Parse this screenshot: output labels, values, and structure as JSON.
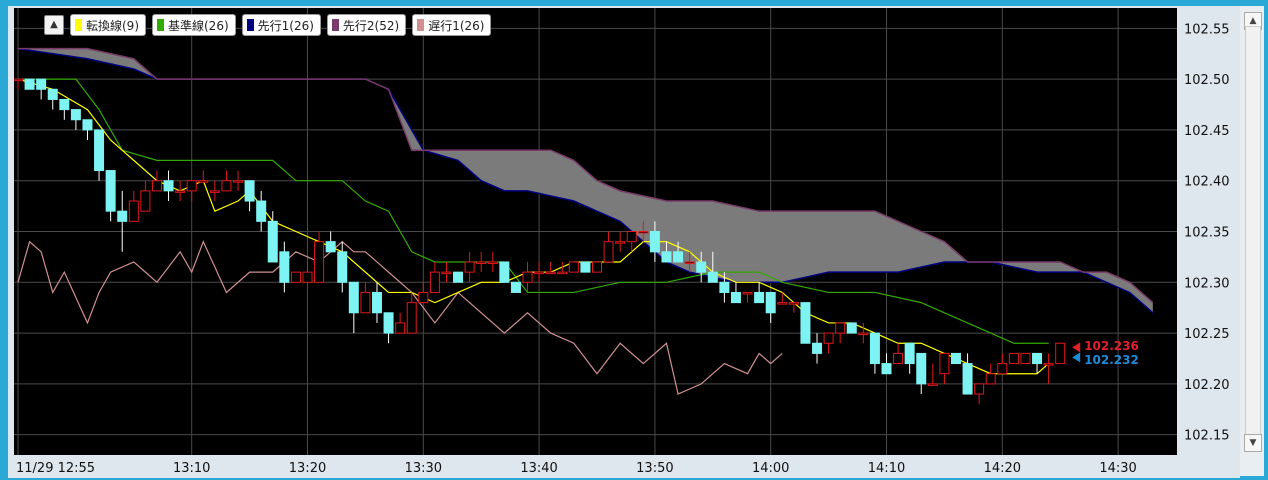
{
  "legend": {
    "collapse_icon": "triangle-up-icon",
    "items": [
      {
        "label": "転換線(9)",
        "color": "#ffff00"
      },
      {
        "label": "基準線(26)",
        "color": "#33aa00"
      },
      {
        "label": "先行1(26)",
        "color": "#000080"
      },
      {
        "label": "先行2(52)",
        "color": "#7a3a6a"
      },
      {
        "label": "遅行1(26)",
        "color": "#d09090"
      }
    ]
  },
  "markers": {
    "ask": {
      "value": "102.236",
      "color": "#e0202a"
    },
    "bid": {
      "value": "102.232",
      "color": "#1e8ad8"
    }
  },
  "scrollbar": {
    "up_icon": "triangle-up-icon",
    "down_icon": "triangle-down-icon"
  },
  "chart_data": {
    "type": "candlestick",
    "y_ticks": [
      "102.55",
      "102.50",
      "102.45",
      "102.40",
      "102.35",
      "102.30",
      "102.25",
      "102.20",
      "102.15"
    ],
    "x_ticks": [
      {
        "label": "11/29 12:55",
        "t": 0
      },
      {
        "label": "13:10",
        "t": 15
      },
      {
        "label": "13:20",
        "t": 25
      },
      {
        "label": "13:30",
        "t": 35
      },
      {
        "label": "13:40",
        "t": 45
      },
      {
        "label": "13:50",
        "t": 55
      },
      {
        "label": "14:00",
        "t": 65
      },
      {
        "label": "14:10",
        "t": 75
      },
      {
        "label": "14:20",
        "t": 85
      },
      {
        "label": "14:30",
        "t": 95
      }
    ],
    "ylim": [
      102.13,
      102.57
    ],
    "xlim": [
      0,
      100
    ],
    "grid": true,
    "series": {
      "tenkan": [
        [
          0,
          102.5
        ],
        [
          3,
          102.49
        ],
        [
          6,
          102.47
        ],
        [
          8,
          102.44
        ],
        [
          10,
          102.42
        ],
        [
          12,
          102.4
        ],
        [
          14,
          102.39
        ],
        [
          16,
          102.4
        ],
        [
          17,
          102.37
        ],
        [
          19,
          102.38
        ],
        [
          20,
          102.39
        ],
        [
          22,
          102.36
        ],
        [
          24,
          102.35
        ],
        [
          26,
          102.34
        ],
        [
          28,
          102.33
        ],
        [
          30,
          102.31
        ],
        [
          32,
          102.29
        ],
        [
          34,
          102.29
        ],
        [
          36,
          102.28
        ],
        [
          38,
          102.29
        ],
        [
          40,
          102.3
        ],
        [
          42,
          102.3
        ],
        [
          44,
          102.31
        ],
        [
          46,
          102.31
        ],
        [
          48,
          102.32
        ],
        [
          50,
          102.32
        ],
        [
          52,
          102.32
        ],
        [
          54,
          102.34
        ],
        [
          56,
          102.34
        ],
        [
          58,
          102.33
        ],
        [
          60,
          102.31
        ],
        [
          62,
          102.3
        ],
        [
          64,
          102.3
        ],
        [
          66,
          102.29
        ],
        [
          68,
          102.27
        ],
        [
          70,
          102.26
        ],
        [
          72,
          102.26
        ],
        [
          74,
          102.25
        ],
        [
          76,
          102.24
        ],
        [
          78,
          102.24
        ],
        [
          80,
          102.23
        ],
        [
          82,
          102.22
        ],
        [
          84,
          102.21
        ],
        [
          86,
          102.21
        ],
        [
          88,
          102.21
        ],
        [
          89,
          102.22
        ]
      ],
      "kijun": [
        [
          0,
          102.5
        ],
        [
          5,
          102.5
        ],
        [
          7,
          102.47
        ],
        [
          9,
          102.43
        ],
        [
          12,
          102.42
        ],
        [
          22,
          102.42
        ],
        [
          24,
          102.4
        ],
        [
          28,
          102.4
        ],
        [
          30,
          102.38
        ],
        [
          32,
          102.37
        ],
        [
          34,
          102.33
        ],
        [
          36,
          102.32
        ],
        [
          42,
          102.32
        ],
        [
          44,
          102.29
        ],
        [
          48,
          102.29
        ],
        [
          52,
          102.3
        ],
        [
          56,
          102.3
        ],
        [
          60,
          102.31
        ],
        [
          64,
          102.31
        ],
        [
          66,
          102.3
        ],
        [
          70,
          102.29
        ],
        [
          74,
          102.29
        ],
        [
          78,
          102.28
        ],
        [
          80,
          102.27
        ],
        [
          84,
          102.25
        ],
        [
          86,
          102.24
        ],
        [
          89,
          102.24
        ]
      ],
      "senkou1": [
        [
          0,
          102.53
        ],
        [
          6,
          102.52
        ],
        [
          10,
          102.51
        ],
        [
          12,
          102.5
        ],
        [
          30,
          102.5
        ],
        [
          32,
          102.49
        ],
        [
          34,
          102.45
        ],
        [
          35,
          102.43
        ],
        [
          38,
          102.42
        ],
        [
          40,
          102.4
        ],
        [
          42,
          102.39
        ],
        [
          44,
          102.39
        ],
        [
          48,
          102.38
        ],
        [
          50,
          102.37
        ],
        [
          52,
          102.36
        ],
        [
          54,
          102.34
        ],
        [
          56,
          102.32
        ],
        [
          58,
          102.31
        ],
        [
          62,
          102.3
        ],
        [
          66,
          102.3
        ],
        [
          70,
          102.31
        ],
        [
          76,
          102.31
        ],
        [
          80,
          102.32
        ],
        [
          84,
          102.32
        ],
        [
          88,
          102.31
        ],
        [
          92,
          102.31
        ],
        [
          96,
          102.29
        ],
        [
          98,
          102.27
        ]
      ],
      "senkou2": [
        [
          0,
          102.53
        ],
        [
          6,
          102.53
        ],
        [
          10,
          102.52
        ],
        [
          12,
          102.5
        ],
        [
          30,
          102.5
        ],
        [
          32,
          102.49
        ],
        [
          34,
          102.43
        ],
        [
          36,
          102.43
        ],
        [
          46,
          102.43
        ],
        [
          48,
          102.42
        ],
        [
          50,
          102.4
        ],
        [
          52,
          102.39
        ],
        [
          56,
          102.38
        ],
        [
          60,
          102.38
        ],
        [
          64,
          102.37
        ],
        [
          70,
          102.37
        ],
        [
          74,
          102.37
        ],
        [
          76,
          102.36
        ],
        [
          78,
          102.35
        ],
        [
          80,
          102.34
        ],
        [
          82,
          102.32
        ],
        [
          86,
          102.32
        ],
        [
          90,
          102.32
        ],
        [
          92,
          102.31
        ],
        [
          94,
          102.31
        ],
        [
          96,
          102.3
        ],
        [
          98,
          102.28
        ]
      ],
      "chikou": [
        [
          0,
          102.3
        ],
        [
          1,
          102.34
        ],
        [
          2,
          102.33
        ],
        [
          3,
          102.29
        ],
        [
          4,
          102.31
        ],
        [
          6,
          102.26
        ],
        [
          7,
          102.29
        ],
        [
          8,
          102.31
        ],
        [
          10,
          102.32
        ],
        [
          11,
          102.31
        ],
        [
          12,
          102.3
        ],
        [
          14,
          102.33
        ],
        [
          15,
          102.31
        ],
        [
          16,
          102.34
        ],
        [
          18,
          102.29
        ],
        [
          20,
          102.31
        ],
        [
          22,
          102.31
        ],
        [
          24,
          102.33
        ],
        [
          26,
          102.32
        ],
        [
          28,
          102.34
        ],
        [
          29,
          102.33
        ],
        [
          30,
          102.33
        ],
        [
          32,
          102.31
        ],
        [
          34,
          102.29
        ],
        [
          36,
          102.26
        ],
        [
          38,
          102.29
        ],
        [
          40,
          102.27
        ],
        [
          42,
          102.25
        ],
        [
          44,
          102.27
        ],
        [
          46,
          102.25
        ],
        [
          48,
          102.24
        ],
        [
          50,
          102.21
        ],
        [
          52,
          102.24
        ],
        [
          54,
          102.22
        ],
        [
          56,
          102.24
        ],
        [
          57,
          102.19
        ],
        [
          59,
          102.2
        ],
        [
          61,
          102.22
        ],
        [
          63,
          102.21
        ],
        [
          64,
          102.23
        ],
        [
          65,
          102.22
        ],
        [
          66,
          102.23
        ]
      ]
    },
    "candles": [
      [
        0,
        102.5,
        102.5,
        102.49,
        102.5
      ],
      [
        1,
        102.5,
        102.5,
        102.49,
        102.49
      ],
      [
        2,
        102.5,
        102.5,
        102.48,
        102.49
      ],
      [
        3,
        102.49,
        102.49,
        102.47,
        102.48
      ],
      [
        4,
        102.48,
        102.48,
        102.46,
        102.47
      ],
      [
        5,
        102.47,
        102.47,
        102.45,
        102.46
      ],
      [
        6,
        102.46,
        102.46,
        102.44,
        102.45
      ],
      [
        7,
        102.45,
        102.45,
        102.4,
        102.41
      ],
      [
        8,
        102.41,
        102.41,
        102.36,
        102.37
      ],
      [
        9,
        102.37,
        102.39,
        102.33,
        102.36
      ],
      [
        10,
        102.36,
        102.39,
        102.36,
        102.38
      ],
      [
        11,
        102.37,
        102.4,
        102.37,
        102.39
      ],
      [
        12,
        102.39,
        102.41,
        102.39,
        102.4
      ],
      [
        13,
        102.4,
        102.41,
        102.38,
        102.39
      ],
      [
        14,
        102.39,
        102.4,
        102.38,
        102.39
      ],
      [
        15,
        102.39,
        102.4,
        102.38,
        102.4
      ],
      [
        16,
        102.4,
        102.41,
        102.4,
        102.4
      ],
      [
        17,
        102.39,
        102.4,
        102.38,
        102.39
      ],
      [
        18,
        102.39,
        102.41,
        102.39,
        102.4
      ],
      [
        19,
        102.4,
        102.41,
        102.39,
        102.4
      ],
      [
        20,
        102.4,
        102.4,
        102.37,
        102.38
      ],
      [
        21,
        102.38,
        102.39,
        102.35,
        102.36
      ],
      [
        22,
        102.36,
        102.37,
        102.32,
        102.32
      ],
      [
        23,
        102.33,
        102.34,
        102.29,
        102.3
      ],
      [
        24,
        102.3,
        102.31,
        102.3,
        102.31
      ],
      [
        25,
        102.3,
        102.32,
        102.3,
        102.31
      ],
      [
        26,
        102.3,
        102.35,
        102.3,
        102.34
      ],
      [
        27,
        102.34,
        102.35,
        102.33,
        102.33
      ],
      [
        28,
        102.33,
        102.34,
        102.29,
        102.3
      ],
      [
        29,
        102.3,
        102.3,
        102.25,
        102.27
      ],
      [
        30,
        102.27,
        102.3,
        102.27,
        102.29
      ],
      [
        31,
        102.29,
        102.3,
        102.26,
        102.27
      ],
      [
        32,
        102.27,
        102.27,
        102.24,
        102.25
      ],
      [
        33,
        102.25,
        102.27,
        102.25,
        102.26
      ],
      [
        34,
        102.25,
        102.29,
        102.25,
        102.28
      ],
      [
        35,
        102.28,
        102.3,
        102.28,
        102.29
      ],
      [
        36,
        102.29,
        102.32,
        102.29,
        102.31
      ],
      [
        37,
        102.31,
        102.32,
        102.3,
        102.31
      ],
      [
        38,
        102.31,
        102.31,
        102.3,
        102.3
      ],
      [
        39,
        102.31,
        102.33,
        102.3,
        102.32
      ],
      [
        40,
        102.32,
        102.33,
        102.31,
        102.32
      ],
      [
        41,
        102.32,
        102.33,
        102.31,
        102.32
      ],
      [
        42,
        102.32,
        102.32,
        102.3,
        102.3
      ],
      [
        43,
        102.3,
        102.3,
        102.29,
        102.29
      ],
      [
        44,
        102.3,
        102.32,
        102.29,
        102.31
      ],
      [
        45,
        102.31,
        102.32,
        102.3,
        102.31
      ],
      [
        46,
        102.31,
        102.32,
        102.31,
        102.31
      ],
      [
        47,
        102.31,
        102.32,
        102.31,
        102.31
      ],
      [
        48,
        102.31,
        102.32,
        102.31,
        102.32
      ],
      [
        49,
        102.32,
        102.32,
        102.31,
        102.31
      ],
      [
        50,
        102.31,
        102.32,
        102.31,
        102.32
      ],
      [
        51,
        102.32,
        102.35,
        102.32,
        102.34
      ],
      [
        52,
        102.34,
        102.35,
        102.33,
        102.34
      ],
      [
        53,
        102.34,
        102.35,
        102.33,
        102.35
      ],
      [
        54,
        102.35,
        102.36,
        102.34,
        102.35
      ],
      [
        55,
        102.35,
        102.36,
        102.32,
        102.33
      ],
      [
        56,
        102.33,
        102.34,
        102.32,
        102.32
      ],
      [
        57,
        102.33,
        102.34,
        102.32,
        102.32
      ],
      [
        58,
        102.32,
        102.33,
        102.31,
        102.32
      ],
      [
        59,
        102.32,
        102.33,
        102.3,
        102.31
      ],
      [
        60,
        102.31,
        102.33,
        102.3,
        102.3
      ],
      [
        61,
        102.3,
        102.31,
        102.28,
        102.29
      ],
      [
        62,
        102.29,
        102.3,
        102.28,
        102.28
      ],
      [
        63,
        102.29,
        102.29,
        102.28,
        102.29
      ],
      [
        64,
        102.29,
        102.3,
        102.28,
        102.28
      ],
      [
        65,
        102.29,
        102.29,
        102.26,
        102.27
      ],
      [
        66,
        102.28,
        102.29,
        102.28,
        102.28
      ],
      [
        67,
        102.28,
        102.28,
        102.27,
        102.28
      ],
      [
        68,
        102.28,
        102.28,
        102.24,
        102.24
      ],
      [
        69,
        102.24,
        102.25,
        102.22,
        102.23
      ],
      [
        70,
        102.24,
        102.25,
        102.23,
        102.25
      ],
      [
        71,
        102.25,
        102.26,
        102.24,
        102.26
      ],
      [
        72,
        102.26,
        102.26,
        102.25,
        102.25
      ],
      [
        73,
        102.25,
        102.26,
        102.24,
        102.25
      ],
      [
        74,
        102.25,
        102.25,
        102.21,
        102.22
      ],
      [
        75,
        102.22,
        102.23,
        102.21,
        102.21
      ],
      [
        76,
        102.22,
        102.24,
        102.22,
        102.23
      ],
      [
        77,
        102.24,
        102.24,
        102.21,
        102.22
      ],
      [
        78,
        102.23,
        102.23,
        102.19,
        102.2
      ],
      [
        79,
        102.2,
        102.22,
        102.2,
        102.2
      ],
      [
        80,
        102.21,
        102.23,
        102.2,
        102.23
      ],
      [
        81,
        102.23,
        102.23,
        102.22,
        102.22
      ],
      [
        82,
        102.22,
        102.23,
        102.19,
        102.19
      ],
      [
        83,
        102.19,
        102.2,
        102.18,
        102.2
      ],
      [
        84,
        102.2,
        102.22,
        102.2,
        102.21
      ],
      [
        85,
        102.21,
        102.23,
        102.21,
        102.22
      ],
      [
        86,
        102.22,
        102.23,
        102.22,
        102.23
      ],
      [
        87,
        102.22,
        102.23,
        102.22,
        102.23
      ],
      [
        88,
        102.23,
        102.23,
        102.21,
        102.22
      ],
      [
        89,
        102.22,
        102.23,
        102.2,
        102.22
      ],
      [
        90,
        102.22,
        102.24,
        102.22,
        102.24
      ]
    ]
  }
}
